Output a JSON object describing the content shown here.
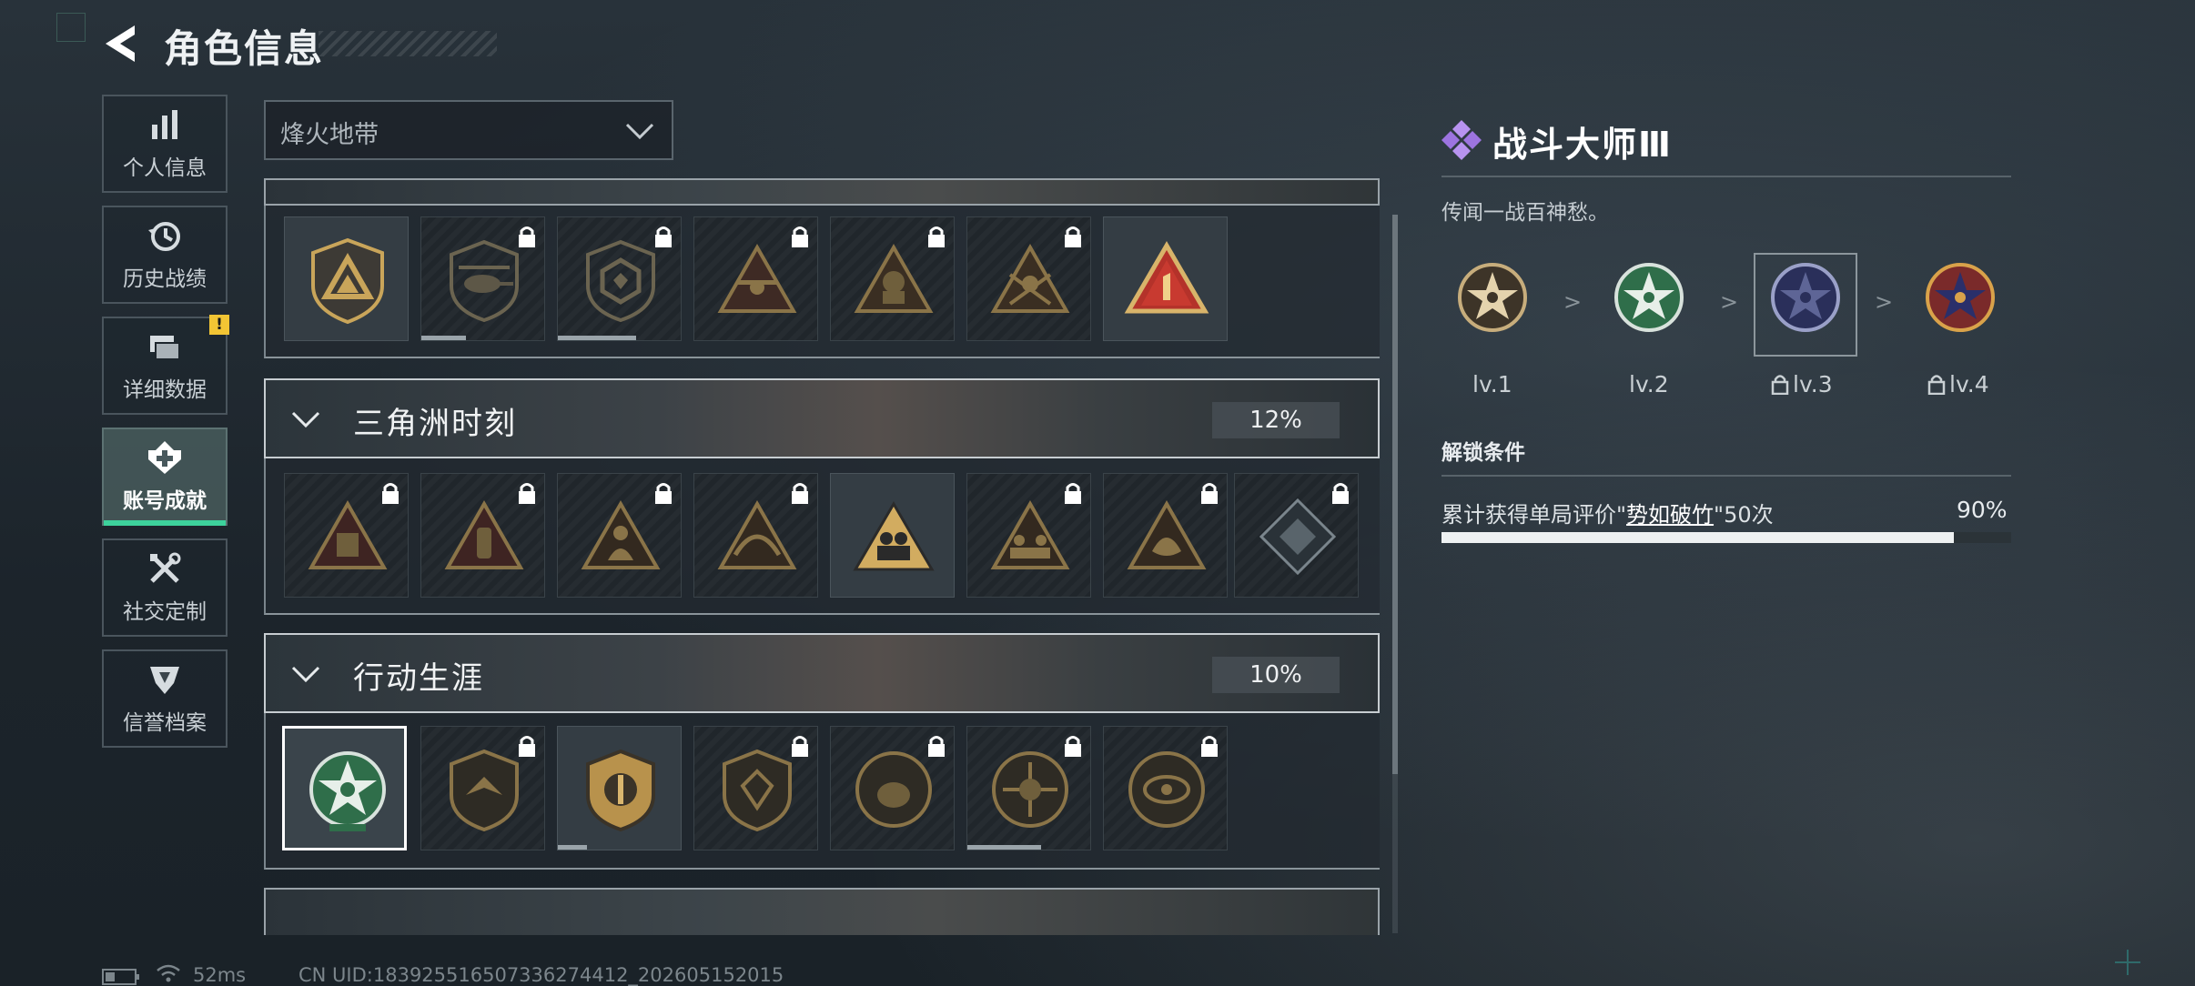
{
  "header": {
    "title": "角色信息"
  },
  "nav": {
    "items": [
      {
        "label": "个人信息",
        "icon": "bar-chart-icon"
      },
      {
        "label": "历史战绩",
        "icon": "history-icon"
      },
      {
        "label": "详细数据",
        "icon": "data-cards-icon",
        "badge": "!"
      },
      {
        "label": "账号成就",
        "icon": "achievement-icon",
        "active": true
      },
      {
        "label": "社交定制",
        "icon": "tools-icon"
      },
      {
        "label": "信誉档案",
        "icon": "reputation-icon"
      }
    ]
  },
  "dropdown": {
    "value": "烽火地带"
  },
  "sections": [
    {
      "title": "三角洲时刻",
      "percent": "12%"
    },
    {
      "title": "行动生涯",
      "percent": "10%"
    }
  ],
  "detail": {
    "title": "战斗大师Ⅲ",
    "description": "传闻一战百神愁。",
    "levels": [
      {
        "label": "lv.1",
        "locked": false
      },
      {
        "label": "lv.2",
        "locked": false
      },
      {
        "label": "lv.3",
        "locked": true,
        "selected": true
      },
      {
        "label": "lv.4",
        "locked": true
      }
    ],
    "level_separator": ">",
    "unlock_title": "解锁条件",
    "condition": {
      "prefix": "累计获得单局评价\"",
      "link": "势如破竹",
      "suffix": "\"50次",
      "percent": "90%",
      "progress": 0.9
    }
  },
  "footer": {
    "ping": "52ms",
    "uid": "CN UID:183925516507336274412_202605152015"
  },
  "colors": {
    "accent_green": "#3dd29c",
    "badge_yellow": "#f2c534",
    "gold": "#c9a55a"
  }
}
